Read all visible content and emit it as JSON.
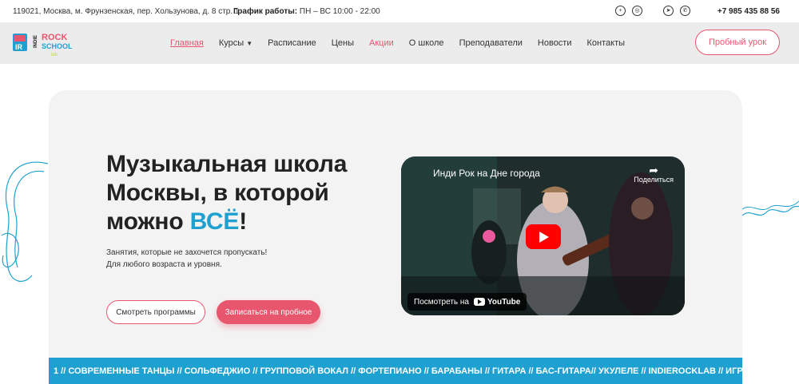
{
  "topbar": {
    "address": "119021, Москва, м. Фрунзенская, пер. Хользунова, д. 8 стр. 1",
    "schedule_label": "График работы:",
    "schedule_value": "ПН – ВС 10:00 - 22:00",
    "socials": [
      "vk-icon",
      "other-icon",
      "telegram-icon",
      "whatsapp-icon"
    ],
    "phone": "+7 985 435 88 56"
  },
  "header": {
    "logo_text": [
      "ROCK",
      "SCHOOL",
      "INDIE"
    ],
    "nav": [
      {
        "label": "Главная"
      },
      {
        "label": "Курсы"
      },
      {
        "label": "Расписание"
      },
      {
        "label": "Цены"
      },
      {
        "label": "Акции"
      },
      {
        "label": "О школе"
      },
      {
        "label": "Преподаватели"
      },
      {
        "label": "Новости"
      },
      {
        "label": "Контакты"
      }
    ],
    "trial_button": "Пробный урок"
  },
  "hero": {
    "title_line1": "Музыкальная школа",
    "title_line2": "Москвы, в которой",
    "title_line3_prefix": "можно ",
    "title_accent": "ВСЁ",
    "title_suffix": "!",
    "subtitle_line1": "Занятия, которые не захочется пропускать!",
    "subtitle_line2": "Для любого возраста и уровня.",
    "btn_programs": "Смотреть программы",
    "btn_trial": "Записаться на пробное"
  },
  "video": {
    "title": "Инди Рок на Дне города",
    "share": "Поделиться",
    "watch_on": "Посмотреть на",
    "youtube": "YouTube"
  },
  "ticker": {
    "text": "1 // СОВРЕМЕННЫЕ ТАНЦЫ // СОЛЬФЕДЖИО // ГРУППОВОЙ ВОКАЛ // ФОРТЕПИАНО // БАРАБАНЫ // ГИТАРА // БАС-ГИТАРА// УКУЛЕЛЕ // INDIEROCKLAB // ИГРА НА МУЗЫКАЛЫ"
  },
  "colors": {
    "accent_pink": "#e8566e",
    "accent_blue": "#1ea1d0"
  }
}
